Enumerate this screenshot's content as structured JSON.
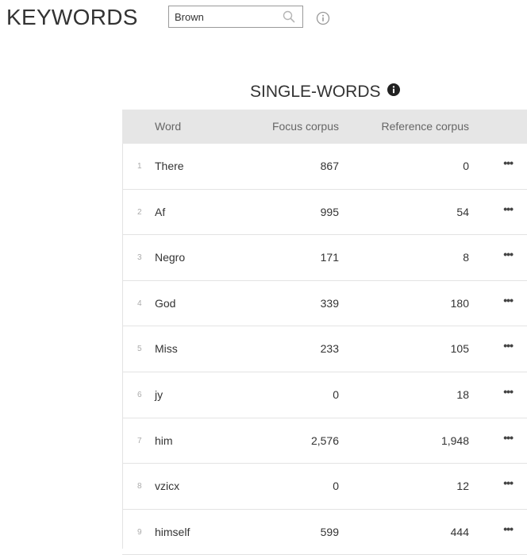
{
  "header": {
    "title": "KEYWORDS",
    "search_value": "Brown",
    "search_placeholder": ""
  },
  "section": {
    "title": "SINGLE-WORDS"
  },
  "table": {
    "columns": {
      "word": "Word",
      "focus": "Focus corpus",
      "reference": "Reference corpus"
    },
    "rows": [
      {
        "num": "1",
        "word": "There",
        "focus": "867",
        "reference": "0"
      },
      {
        "num": "2",
        "word": "Af",
        "focus": "995",
        "reference": "54"
      },
      {
        "num": "3",
        "word": "Negro",
        "focus": "171",
        "reference": "8"
      },
      {
        "num": "4",
        "word": "God",
        "focus": "339",
        "reference": "180"
      },
      {
        "num": "5",
        "word": "Miss",
        "focus": "233",
        "reference": "105"
      },
      {
        "num": "6",
        "word": "jy",
        "focus": "0",
        "reference": "18"
      },
      {
        "num": "7",
        "word": "him",
        "focus": "2,576",
        "reference": "1,948"
      },
      {
        "num": "8",
        "word": "vzicx",
        "focus": "0",
        "reference": "12"
      },
      {
        "num": "9",
        "word": "himself",
        "focus": "599",
        "reference": "444"
      }
    ],
    "menu_glyph": "•••"
  },
  "icons": {
    "search": "search-icon",
    "info_outline": "info-outline-icon",
    "info_solid": "info-solid-icon",
    "row_menu": "more-horizontal-icon"
  },
  "colors": {
    "header_bg": "#e6e6e6",
    "text": "#333333",
    "row_border": "#e3e3e3"
  }
}
